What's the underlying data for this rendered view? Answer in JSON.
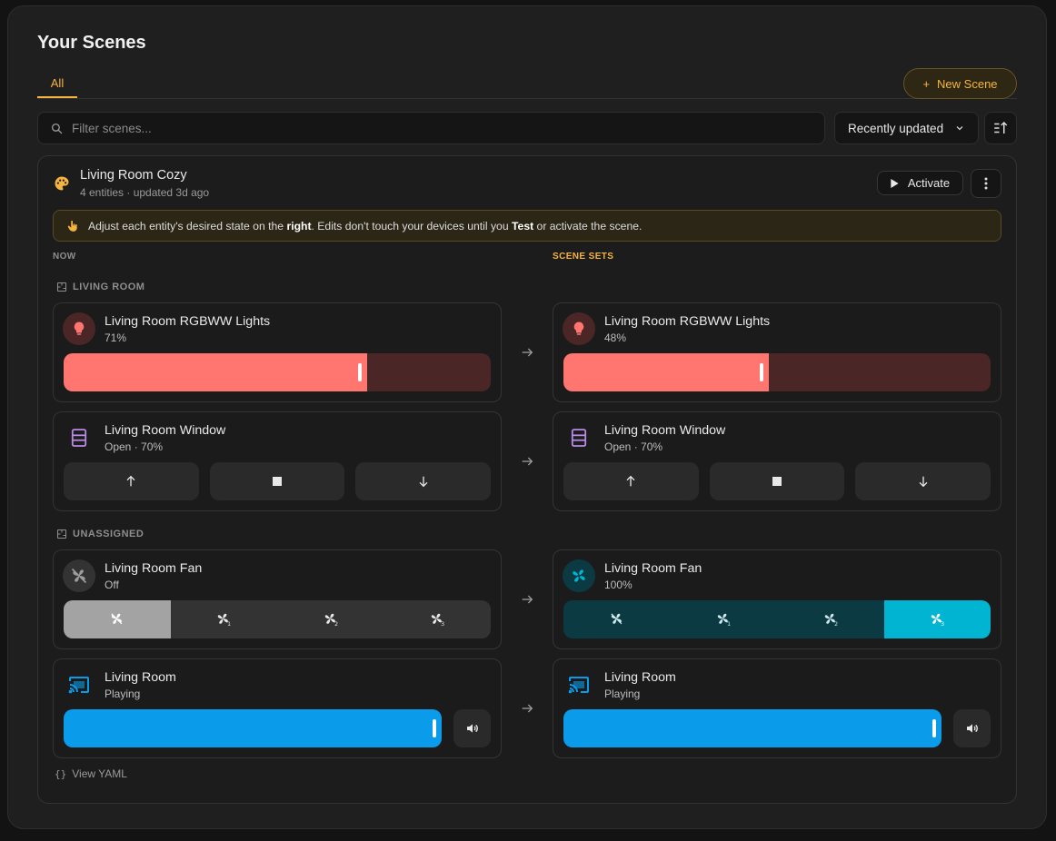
{
  "page": {
    "title": "Your Scenes",
    "tabs": [
      {
        "label": "All",
        "active": true
      }
    ],
    "new_scene_label": "New Scene",
    "new_scene_prefix": "+",
    "search_placeholder": "Filter scenes...",
    "sort": {
      "selected": "Recently updated"
    }
  },
  "scene": {
    "name": "Living Room Cozy",
    "meta": "4 entities · updated 3d ago",
    "activate_label": "Activate",
    "notice": {
      "t1": "Adjust each entity's desired state on the ",
      "b1": "right",
      "t2": ". Edits don't touch your devices until you ",
      "b2": "Test",
      "t3": " or activate the scene."
    },
    "col_now": "NOW",
    "col_sets": "SCENE SETS",
    "groups": [
      {
        "label": "LIVING ROOM"
      },
      {
        "label": "UNASSIGNED"
      }
    ],
    "entities": {
      "lights": {
        "name": "Living Room RGBWW Lights",
        "now": {
          "state": "71%",
          "level": 0.71
        },
        "set": {
          "state": "48%",
          "level": 0.48
        },
        "color": "#ff7570",
        "track_color": "#4a2626"
      },
      "window": {
        "name": "Living Room Window",
        "now": {
          "state": "Open · 70%"
        },
        "set": {
          "state": "Open · 70%"
        },
        "icon_color": "#b78ae6"
      },
      "fan": {
        "name": "Living Room Fan",
        "now": {
          "state": "Off",
          "selected_speed": 0
        },
        "set": {
          "state": "100%",
          "selected_speed": 3
        },
        "speeds": [
          "off",
          "1",
          "2",
          "3"
        ],
        "active_color": "#00b4d2"
      },
      "media": {
        "name": "Living Room",
        "now": {
          "state": "Playing",
          "level": 1.0
        },
        "set": {
          "state": "Playing",
          "level": 1.0
        },
        "color": "#0a9cea"
      }
    },
    "yaml_label": "View YAML"
  },
  "colors": {
    "accent": "#f5b340",
    "background": "#1f1f1f"
  }
}
